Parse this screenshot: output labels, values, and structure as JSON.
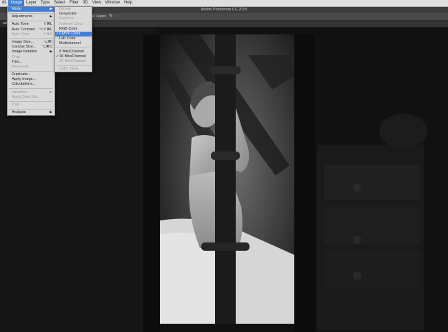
{
  "menubar": {
    "items": [
      "dit",
      "Image",
      "Layer",
      "Type",
      "Select",
      "Filter",
      "3D",
      "View",
      "Window",
      "Help"
    ],
    "active": "Image"
  },
  "window": {
    "title": "Adobe Photoshop CC 2015"
  },
  "options_bar": {
    "sample_label": "mple All Layers",
    "brush_symbol": "✎"
  },
  "doc_tab": {
    "name": "ash_L",
    "zoom": "8)"
  },
  "image_menu": {
    "mode": "Mode",
    "adjustments": "Adjustments",
    "auto_tone": "Auto Tone",
    "auto_tone_sc": "⇧⌘L",
    "auto_contrast": "Auto Contrast",
    "auto_contrast_sc": "⌥⇧⌘L",
    "auto_color": "Auto Color",
    "auto_color_sc": "⇧⌘B",
    "image_size": "Image Size...",
    "image_size_sc": "⌥⌘I",
    "canvas_size": "Canvas Size...",
    "canvas_size_sc": "⌥⌘C",
    "image_rotation": "Image Rotation",
    "crop": "Crop",
    "trim": "Trim...",
    "reveal_all": "Reveal All",
    "duplicate": "Duplicate...",
    "apply_image": "Apply Image...",
    "calculations": "Calculations...",
    "variables": "Variables",
    "apply_data_set": "Apply Data Set...",
    "trap": "Trap...",
    "analysis": "Analysis"
  },
  "mode_menu": {
    "bitmap": "Bitmap",
    "grayscale": "Grayscale",
    "duotone": "Duotone",
    "indexed_color": "Indexed Color",
    "rgb_color": "RGB Color",
    "cmyk_color": "CMYK Color",
    "lab_color": "Lab Color",
    "multichannel": "Multichannel",
    "bits8": "8 Bits/Channel",
    "bits16": "16 Bits/Channel",
    "bits32": "32 Bits/Channel",
    "color_table": "Color Table...",
    "checkmark": "✓"
  },
  "glyphs": {
    "submenu_arrow": "▶"
  },
  "colors": {
    "menu_highlight": "#3f7fd9",
    "menu_bg": "#d9d9d9",
    "canvas_bg": "#0f0f0f"
  }
}
